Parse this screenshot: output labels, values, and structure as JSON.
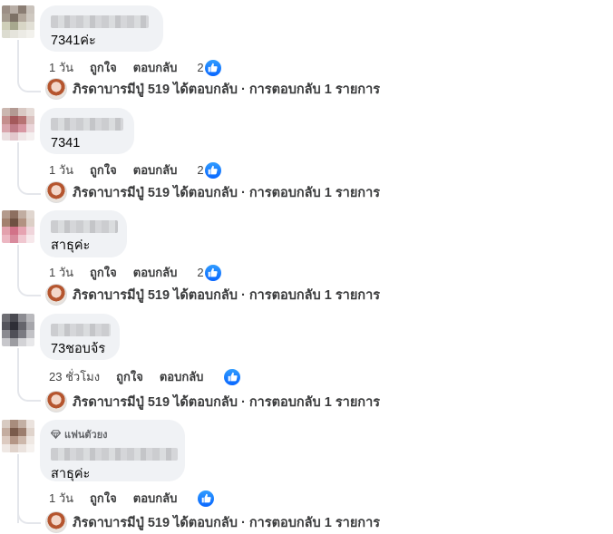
{
  "colors": {
    "bubble": "#f0f2f5",
    "like_blue": "#0866ff",
    "meta_text": "#65676b",
    "thread_line": "#e4e6eb"
  },
  "reply_summary": {
    "author": "ภิรดาบารมีปู่ 519",
    "text": "ได้ตอบกลับ · การตอบกลับ 1 รายการ"
  },
  "comments": [
    {
      "text": "7341ค่ะ",
      "time": "1 วัน",
      "like_label": "ถูกใจ",
      "reply_label": "ตอบกลับ",
      "reaction_count": "2",
      "reaction_icon": "like-icon"
    },
    {
      "text": "7341",
      "time": "1 วัน",
      "like_label": "ถูกใจ",
      "reply_label": "ตอบกลับ",
      "reaction_count": "2",
      "reaction_icon": "like-icon"
    },
    {
      "text": "สาธุค่ะ",
      "time": "1 วัน",
      "like_label": "ถูกใจ",
      "reply_label": "ตอบกลับ",
      "reaction_count": "2",
      "reaction_icon": "like-icon"
    },
    {
      "text": "73ชอบจ้ร",
      "time": "23 ชั่วโมง",
      "like_label": "ถูกใจ",
      "reply_label": "ตอบกลับ",
      "reaction_count": "",
      "reaction_icon": "like-icon"
    },
    {
      "text": "สาธุค่ะ",
      "badge": "แฟนตัวยง",
      "time": "1 วัน",
      "like_label": "ถูกใจ",
      "reply_label": "ตอบกลับ",
      "reaction_count": "",
      "reaction_icon": "like-icon"
    }
  ]
}
